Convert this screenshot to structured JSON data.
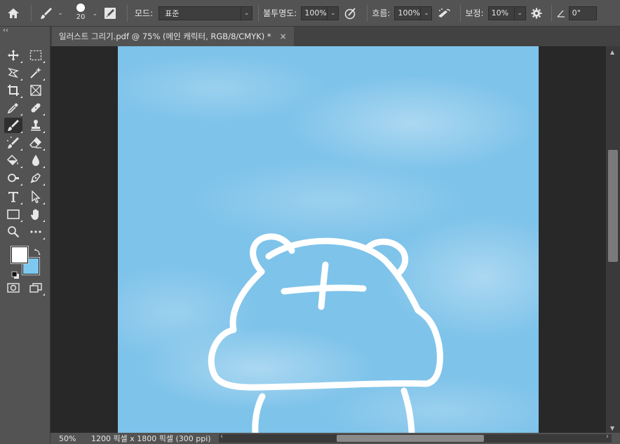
{
  "options_bar": {
    "brush_size": "20",
    "mode_label": "모드:",
    "mode_value": "표준",
    "opacity_label": "불투명도:",
    "opacity_value": "100%",
    "flow_label": "흐름:",
    "flow_value": "100%",
    "smoothing_label": "보정:",
    "smoothing_value": "10%",
    "angle_value": "0°"
  },
  "document": {
    "tab_title": "일러스트 그리기.pdf @ 75% (메인 캐릭터, RGB/8/CMYK) *",
    "close_symbol": "×"
  },
  "status_bar": {
    "zoom": "50%",
    "doc_info": "1200 픽셀 x 1800 픽셀 (300 ppi)",
    "arrow": "›"
  },
  "colors": {
    "foreground": "#ffffff",
    "background": "#7ec8f0",
    "canvas_sky": "#7ec3ea"
  },
  "tools": [
    "move-icon",
    "marquee-icon",
    "lasso-icon",
    "magic-wand-icon",
    "crop-icon",
    "frame-icon",
    "eyedropper-icon",
    "healing-brush-icon",
    "brush-icon",
    "stamp-icon",
    "history-brush-icon",
    "eraser-icon",
    "paint-bucket-icon",
    "blur-icon",
    "dodge-icon",
    "pen-icon",
    "type-icon",
    "path-select-icon",
    "rectangle-icon",
    "hand-icon",
    "zoom-icon",
    "more-tools-icon"
  ]
}
